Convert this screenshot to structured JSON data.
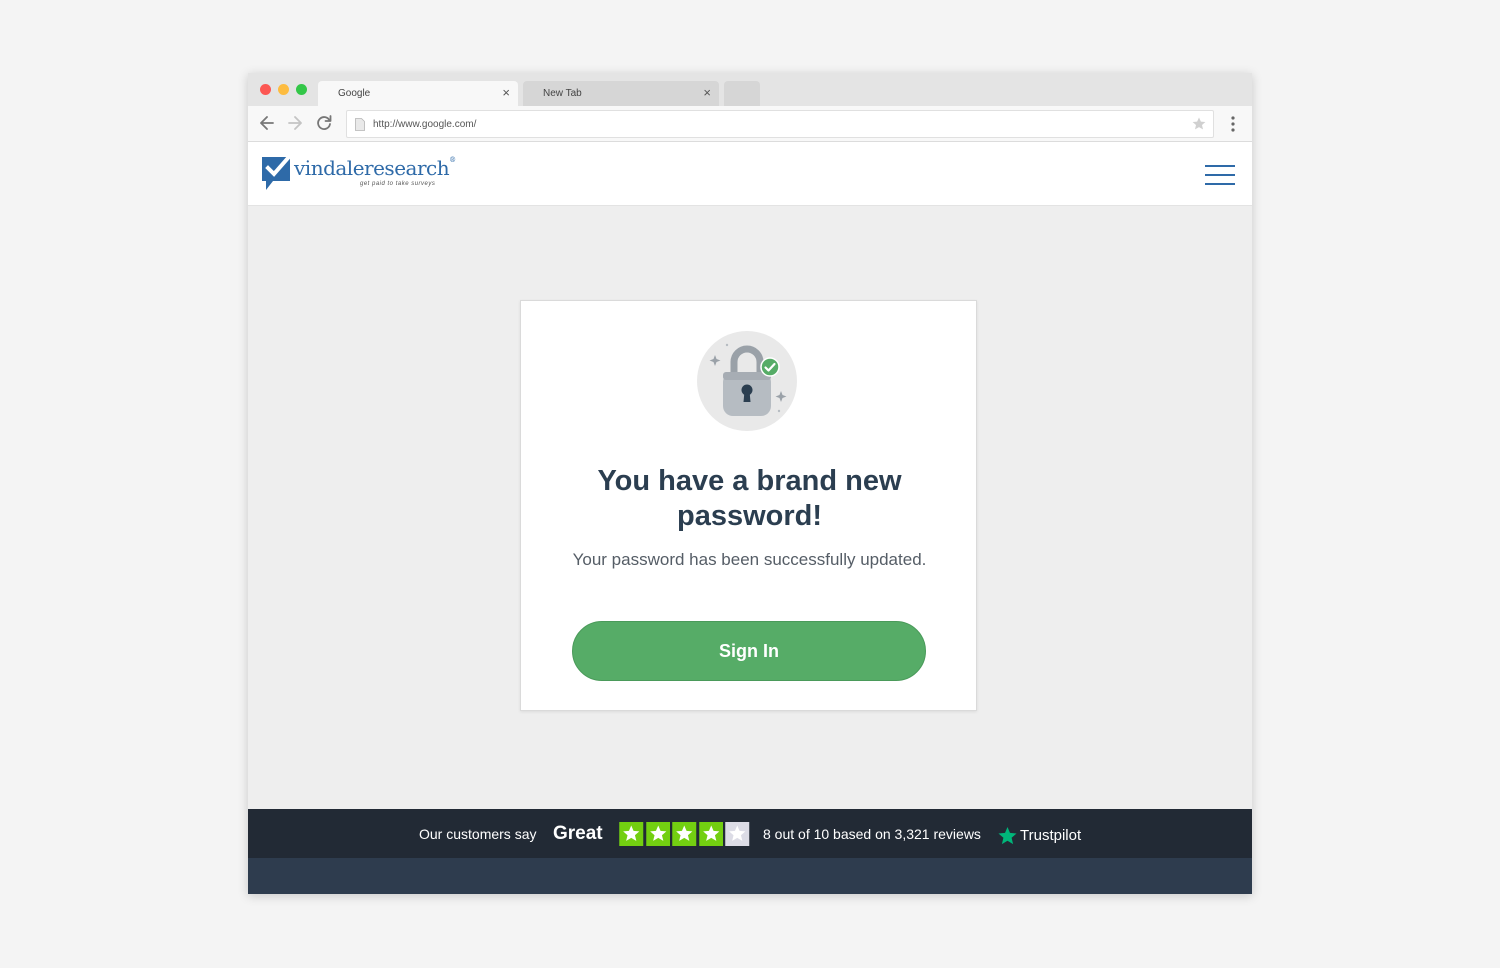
{
  "browser": {
    "tabs": [
      {
        "label": "Google",
        "close": "×"
      },
      {
        "label": "New Tab",
        "close": "×"
      }
    ],
    "url": "http://www.google.com/"
  },
  "site": {
    "logo_name": "vindaleresearch",
    "logo_reg": "®",
    "logo_tagline": "get paid to take surveys"
  },
  "card": {
    "title": "You have a brand new password!",
    "subtitle": "Your password has been successfully updated.",
    "button_label": "Sign In"
  },
  "trustpilot": {
    "say": "Our customers say",
    "rating_word": "Great",
    "stars_filled": 4,
    "stars_total": 5,
    "reviews_text": "8 out of 10 based on 3,321 reviews",
    "brand": "Trustpilot"
  },
  "colors": {
    "brand_blue": "#2e6aa8",
    "button_green": "#56ac67",
    "trust_green": "#73cf11",
    "footer_dark": "#222a35"
  }
}
